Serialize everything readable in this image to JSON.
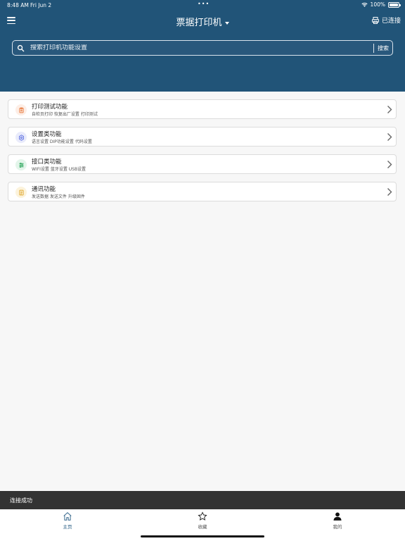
{
  "status_bar": {
    "time": "8:48 AM",
    "date": "Fri Jun 2",
    "battery_pct": "100%",
    "battery_level": 1.0
  },
  "header": {
    "title": "票据打印机",
    "connection_status": "已连接",
    "menu_icon": "hamburger-menu-icon",
    "printer_icon": "printer-icon"
  },
  "search": {
    "placeholder": "搜索打印机功能设置",
    "button_label": "搜索"
  },
  "items": [
    {
      "title": "打印测试功能",
      "subtitle": "自检页打印 恢复出厂设置 打印测试",
      "icon": "clipboard-icon",
      "icon_color": "#e8793d",
      "icon_bg": "#fdeee6"
    },
    {
      "title": "设置类功能",
      "subtitle": "语言设置 DIP功能设置 代码设置",
      "icon": "settings-icon",
      "icon_color": "#5b6ee1",
      "icon_bg": "#e9ebfb"
    },
    {
      "title": "接口类功能",
      "subtitle": "WIFI设置 蓝牙设置 USB设置",
      "icon": "sliders-icon",
      "icon_color": "#2aa55a",
      "icon_bg": "#e3f5ea"
    },
    {
      "title": "通讯功能",
      "subtitle": "发送数据 发送文件 升级固件",
      "icon": "document-icon",
      "icon_color": "#e0a82e",
      "icon_bg": "#fcf3dc"
    }
  ],
  "toast": {
    "message": "连接成功"
  },
  "tabs": [
    {
      "label": "主页",
      "icon": "home-icon",
      "active": true
    },
    {
      "label": "收藏",
      "icon": "star-icon",
      "active": false
    },
    {
      "label": "我的",
      "icon": "user-icon",
      "active": false
    }
  ],
  "colors": {
    "header_bg": "#215478",
    "accent": "#2b5f86",
    "toast_bg": "#333333",
    "page_bg": "#f7f7f7"
  }
}
